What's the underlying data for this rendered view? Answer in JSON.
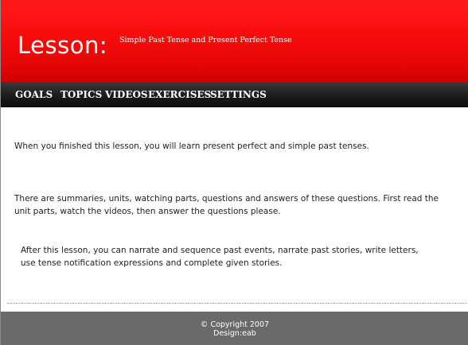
{
  "header": {
    "brand": "Lesson:",
    "subtitle": "Simple Past Tense and Present Perfect Tense"
  },
  "nav": {
    "goals": "GOALS",
    "topics": "TOPICS",
    "videos": "VIDEOS",
    "exercises": "EXERCISES",
    "settings": "SETTINGS"
  },
  "content": {
    "paragraphs": [
      "When you finished this lesson, you will learn present perfect and simple past tenses.",
      "There are summaries, units, watching parts, questions and answers of these questions. First read the",
      "unit parts, watch the videos, then answer the questions please.",
      "After this lesson, you can narrate and sequence past events, narrate past stories, write letters,",
      "use tense notification expressions and complete given stories."
    ]
  },
  "footer": {
    "copyright": "© Copyright 2007",
    "design": "Design:eab"
  },
  "colors": {
    "header_red": "#f80c0c",
    "navbar_black": "#1c1c1c",
    "footer_gray": "#6a6a6a",
    "text": "#222222"
  }
}
